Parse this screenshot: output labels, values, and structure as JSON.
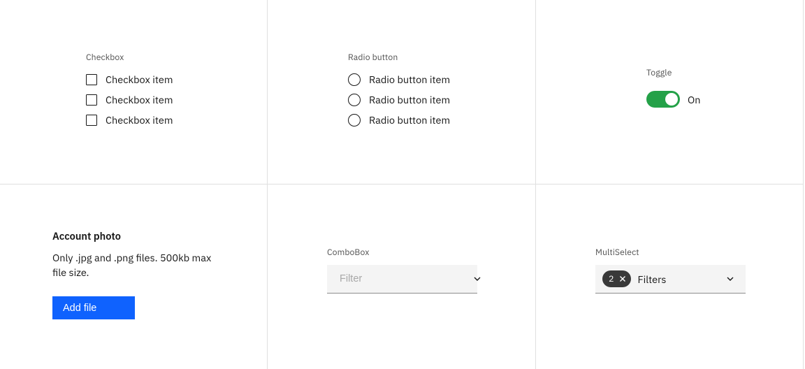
{
  "checkbox": {
    "label": "Checkbox",
    "items": [
      "Checkbox item",
      "Checkbox item",
      "Checkbox item"
    ]
  },
  "radio": {
    "label": "Radio button",
    "items": [
      "Radio button item",
      "Radio button item",
      "Radio button item"
    ]
  },
  "toggle": {
    "label": "Toggle",
    "state_label": "On"
  },
  "file": {
    "title": "Account photo",
    "description": "Only .jpg and .png files. 500kb max file size.",
    "button": "Add file"
  },
  "combo": {
    "label": "ComboBox",
    "placeholder": "Filter"
  },
  "multi": {
    "label": "MultiSelect",
    "selected_count": "2",
    "text": "Filters"
  }
}
